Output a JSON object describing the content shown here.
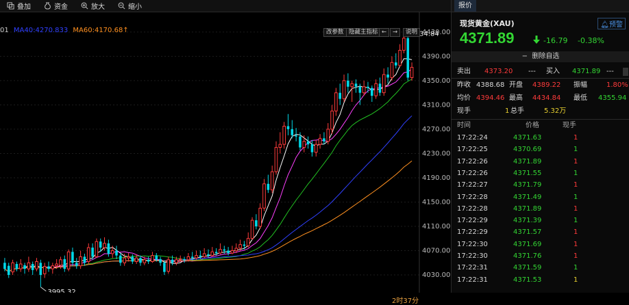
{
  "toolbar": {
    "overlay": "叠加",
    "capital": "资金",
    "zoom_in": "放大",
    "zoom_out": "缩小"
  },
  "chart": {
    "ma_prefix": "01",
    "ma_partial": "MA40:4270.833",
    "ma60": "MA60:4170.68↑",
    "btn_params": "改参数",
    "btn_hide": "隐藏主指标",
    "btn_left": "←",
    "btn_right": "→",
    "btn_help": "说明",
    "duration": "2时37分",
    "colors": {
      "up": "#ff3b3b",
      "down": "#00d8e8",
      "ma5": "#ffffff",
      "ma10": "#ff40ff",
      "ma20": "#22c022",
      "ma40": "#3040ff",
      "ma60": "#ff9020"
    }
  },
  "chart_data": {
    "type": "candlestick",
    "y_ticks": [
      "4430.00",
      "4390.00",
      "4350.00",
      "4310.00",
      "4270.00",
      "4230.00",
      "4190.00",
      "4150.00",
      "4110.00",
      "4070.00",
      "4030.00"
    ],
    "ylim": [
      4012,
      4440
    ],
    "high_label": "4434.84",
    "low_label": "3995.32",
    "candles": [
      [
        4050,
        4040,
        4058,
        4036
      ],
      [
        4045,
        4030,
        4050,
        4025
      ],
      [
        4035,
        4050,
        4055,
        4030
      ],
      [
        4048,
        4040,
        4052,
        4036
      ],
      [
        4040,
        4048,
        4056,
        4035
      ],
      [
        4046,
        4040,
        4050,
        4032
      ],
      [
        4040,
        4050,
        4060,
        4035
      ],
      [
        4048,
        4038,
        4052,
        4030
      ],
      [
        4040,
        4052,
        4058,
        4036
      ],
      [
        4050,
        4030,
        4055,
        4010
      ],
      [
        4032,
        4044,
        4050,
        4025
      ],
      [
        4044,
        4040,
        4052,
        4035
      ],
      [
        4040,
        4045,
        4050,
        4032
      ],
      [
        4045,
        4048,
        4056,
        4040
      ],
      [
        4046,
        4055,
        4060,
        4040
      ],
      [
        4056,
        4040,
        4062,
        4035
      ],
      [
        4040,
        4068,
        4072,
        4036
      ],
      [
        4068,
        4050,
        4075,
        4045
      ],
      [
        4050,
        4045,
        4058,
        4040
      ],
      [
        4045,
        4060,
        4070,
        4040
      ],
      [
        4060,
        4050,
        4065,
        4045
      ],
      [
        4052,
        4075,
        4082,
        4048
      ],
      [
        4075,
        4060,
        4082,
        4055
      ],
      [
        4060,
        4085,
        4090,
        4058
      ],
      [
        4085,
        4075,
        4090,
        4068
      ],
      [
        4075,
        4082,
        4092,
        4070
      ],
      [
        4082,
        4065,
        4088,
        4060
      ],
      [
        4065,
        4070,
        4078,
        4058
      ],
      [
        4070,
        4062,
        4078,
        4056
      ],
      [
        4062,
        4050,
        4066,
        4045
      ],
      [
        4050,
        4058,
        4065,
        4045
      ],
      [
        4058,
        4060,
        4066,
        4052
      ],
      [
        4060,
        4052,
        4064,
        4048
      ],
      [
        4052,
        4058,
        4064,
        4048
      ],
      [
        4058,
        4050,
        4062,
        4045
      ],
      [
        4050,
        4055,
        4060,
        4046
      ],
      [
        4055,
        4052,
        4060,
        4048
      ],
      [
        4052,
        4062,
        4068,
        4050
      ],
      [
        4062,
        4055,
        4066,
        4052
      ],
      [
        4056,
        4050,
        4060,
        4045
      ],
      [
        4050,
        4035,
        4054,
        4030
      ],
      [
        4036,
        4055,
        4060,
        4032
      ],
      [
        4055,
        4050,
        4062,
        4046
      ],
      [
        4050,
        4055,
        4060,
        4046
      ],
      [
        4055,
        4056,
        4062,
        4052
      ],
      [
        4056,
        4055,
        4060,
        4050
      ],
      [
        4055,
        4060,
        4066,
        4052
      ],
      [
        4060,
        4058,
        4068,
        4054
      ],
      [
        4058,
        4062,
        4070,
        4055
      ],
      [
        4062,
        4060,
        4070,
        4056
      ],
      [
        4060,
        4065,
        4074,
        4058
      ],
      [
        4064,
        4062,
        4072,
        4058
      ],
      [
        4062,
        4068,
        4076,
        4060
      ],
      [
        4068,
        4066,
        4074,
        4062
      ],
      [
        4066,
        4072,
        4082,
        4064
      ],
      [
        4072,
        4070,
        4078,
        4065
      ],
      [
        4070,
        4066,
        4076,
        4062
      ],
      [
        4066,
        4070,
        4078,
        4064
      ],
      [
        4070,
        4074,
        4082,
        4066
      ],
      [
        4074,
        4080,
        4088,
        4070
      ],
      [
        4080,
        4078,
        4086,
        4072
      ],
      [
        4078,
        4090,
        4100,
        4075
      ],
      [
        4090,
        4120,
        4125,
        4088
      ],
      [
        4120,
        4110,
        4130,
        4105
      ],
      [
        4110,
        4140,
        4148,
        4106
      ],
      [
        4140,
        4180,
        4188,
        4135
      ],
      [
        4180,
        4170,
        4195,
        4165
      ],
      [
        4170,
        4200,
        4210,
        4165
      ],
      [
        4200,
        4240,
        4250,
        4195
      ],
      [
        4240,
        4245,
        4265,
        4230
      ],
      [
        4245,
        4275,
        4282,
        4238
      ],
      [
        4275,
        4270,
        4295,
        4260
      ],
      [
        4270,
        4260,
        4285,
        4255
      ],
      [
        4260,
        4258,
        4272,
        4250
      ],
      [
        4258,
        4240,
        4265,
        4235
      ],
      [
        4240,
        4250,
        4260,
        4232
      ],
      [
        4250,
        4245,
        4258,
        4238
      ],
      [
        4245,
        4232,
        4252,
        4225
      ],
      [
        4232,
        4245,
        4252,
        4225
      ],
      [
        4245,
        4255,
        4262,
        4238
      ],
      [
        4255,
        4250,
        4265,
        4245
      ],
      [
        4250,
        4270,
        4280,
        4245
      ],
      [
        4270,
        4300,
        4310,
        4262
      ],
      [
        4300,
        4330,
        4338,
        4292
      ],
      [
        4330,
        4320,
        4345,
        4310
      ],
      [
        4320,
        4350,
        4360,
        4315
      ],
      [
        4350,
        4340,
        4362,
        4330
      ],
      [
        4340,
        4345,
        4350,
        4315
      ],
      [
        4345,
        4340,
        4352,
        4330
      ],
      [
        4340,
        4330,
        4345,
        4310
      ],
      [
        4330,
        4340,
        4350,
        4325
      ],
      [
        4340,
        4338,
        4348,
        4330
      ],
      [
        4338,
        4325,
        4342,
        4315
      ],
      [
        4325,
        4345,
        4352,
        4320
      ],
      [
        4345,
        4330,
        4355,
        4325
      ],
      [
        4330,
        4360,
        4370,
        4325
      ],
      [
        4360,
        4355,
        4372,
        4345
      ],
      [
        4355,
        4380,
        4390,
        4350
      ],
      [
        4380,
        4375,
        4395,
        4370
      ],
      [
        4375,
        4400,
        4410,
        4372
      ],
      [
        4400,
        4420,
        4434.84,
        4395
      ],
      [
        4420,
        4355,
        4428,
        4350
      ],
      [
        4355,
        4372,
        4380,
        4350
      ]
    ]
  },
  "quote": {
    "tab_label": "报价",
    "symbol": "现货黄金(XAU)",
    "alert_label": "预警",
    "price": "4371.89",
    "change": "-16.79",
    "change_pct": "-0.38%",
    "watch_label": "删除自选",
    "sell_label": "卖出",
    "sell_value": "4373.20",
    "sell_vol": "---",
    "buy_label": "买入",
    "buy_value": "4371.89",
    "buy_vol": "---",
    "prev_close_label": "昨收",
    "prev_close": "4388.68",
    "open_label": "开盘",
    "open": "4389.22",
    "amplitude_label": "振幅",
    "amplitude": "1.80%",
    "avg_label": "均价",
    "avg": "4394.46",
    "high_label": "最高",
    "high": "4434.84",
    "low_label": "最低",
    "low": "4355.94",
    "cur_hand_label": "现手",
    "cur_hand": "1",
    "total_hand_label": "总手",
    "total_hand": "5.32万"
  },
  "ticks": {
    "headers": [
      "时间",
      "价格",
      "现手"
    ],
    "rows": [
      {
        "time": "17:22:24",
        "price": "4371.63",
        "vol": "1",
        "price_color": "green",
        "vol_color": "red"
      },
      {
        "time": "17:22:25",
        "price": "4370.69",
        "vol": "1",
        "price_color": "green",
        "vol_color": "green"
      },
      {
        "time": "17:22:26",
        "price": "4371.89",
        "vol": "1",
        "price_color": "green",
        "vol_color": "red"
      },
      {
        "time": "17:22:26",
        "price": "4371.55",
        "vol": "1",
        "price_color": "green",
        "vol_color": "green"
      },
      {
        "time": "17:22:27",
        "price": "4371.79",
        "vol": "1",
        "price_color": "green",
        "vol_color": "red"
      },
      {
        "time": "17:22:28",
        "price": "4371.49",
        "vol": "1",
        "price_color": "green",
        "vol_color": "green"
      },
      {
        "time": "17:22:28",
        "price": "4371.89",
        "vol": "1",
        "price_color": "green",
        "vol_color": "red"
      },
      {
        "time": "17:22:29",
        "price": "4371.39",
        "vol": "1",
        "price_color": "green",
        "vol_color": "green"
      },
      {
        "time": "17:22:29",
        "price": "4371.57",
        "vol": "1",
        "price_color": "green",
        "vol_color": "red"
      },
      {
        "time": "17:22:30",
        "price": "4371.69",
        "vol": "1",
        "price_color": "green",
        "vol_color": "red"
      },
      {
        "time": "17:22:30",
        "price": "4371.76",
        "vol": "1",
        "price_color": "green",
        "vol_color": "red"
      },
      {
        "time": "17:22:31",
        "price": "4371.59",
        "vol": "1",
        "price_color": "green",
        "vol_color": "green"
      },
      {
        "time": "17:22:31",
        "price": "4371.53",
        "vol": "1",
        "price_color": "green",
        "vol_color": "yellow"
      }
    ]
  }
}
